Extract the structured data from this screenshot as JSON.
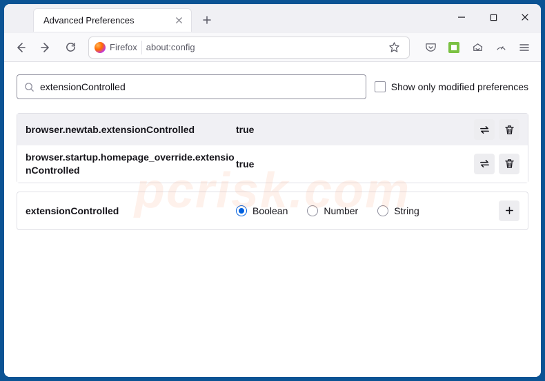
{
  "tab": {
    "title": "Advanced Preferences"
  },
  "urlbar": {
    "label": "Firefox",
    "address": "about:config"
  },
  "search": {
    "value": "extensionControlled"
  },
  "checkbox_label": "Show only modified preferences",
  "prefs": [
    {
      "name": "browser.newtab.extensionControlled",
      "value": "true"
    },
    {
      "name": "browser.startup.homepage_override.extensionControlled",
      "value": "true"
    }
  ],
  "add": {
    "name": "extensionControlled",
    "types": {
      "boolean": "Boolean",
      "number": "Number",
      "string": "String"
    }
  },
  "watermark": "pcrisk.com"
}
